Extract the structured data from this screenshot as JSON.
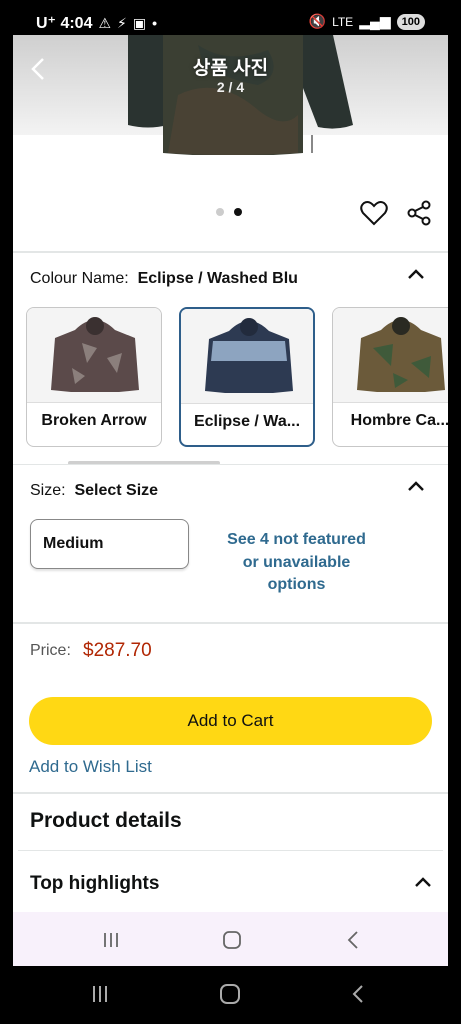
{
  "status_bar": {
    "carrier_time": "U⁺ 4:04",
    "battery": "100",
    "network": "LTE"
  },
  "gallery": {
    "title": "상품 사진",
    "counter": "2 / 4",
    "dots_total": 2,
    "dots_active": 1
  },
  "colour": {
    "label": "Colour Name:",
    "selected": "Eclipse / Washed Blu",
    "options": [
      {
        "label": "Broken Arrow",
        "selected": false,
        "colors": [
          "#5b4a4a",
          "#8b7f7c"
        ]
      },
      {
        "label": "Eclipse / Wa...",
        "selected": true,
        "colors": [
          "#2d3a52",
          "#8da4c0"
        ]
      },
      {
        "label": "Hombre Ca...",
        "selected": false,
        "colors": [
          "#6b5a3a",
          "#3f5a3a"
        ]
      }
    ]
  },
  "size": {
    "label": "Size:",
    "selected_text": "Select Size",
    "dropdown_value": "Medium",
    "more_options": "See 4 not featured or unavailable options"
  },
  "price": {
    "label": "Price:",
    "value": "$287.70"
  },
  "actions": {
    "add_to_cart": "Add to Cart",
    "add_to_wish_list": "Add to Wish List"
  },
  "sections": {
    "product_details": "Product details",
    "top_highlights": "Top highlights"
  },
  "colors": {
    "cart_button": "#ffd814",
    "link": "#2f6a8f",
    "price": "#b12704",
    "selected_border": "#2e5e8a"
  }
}
